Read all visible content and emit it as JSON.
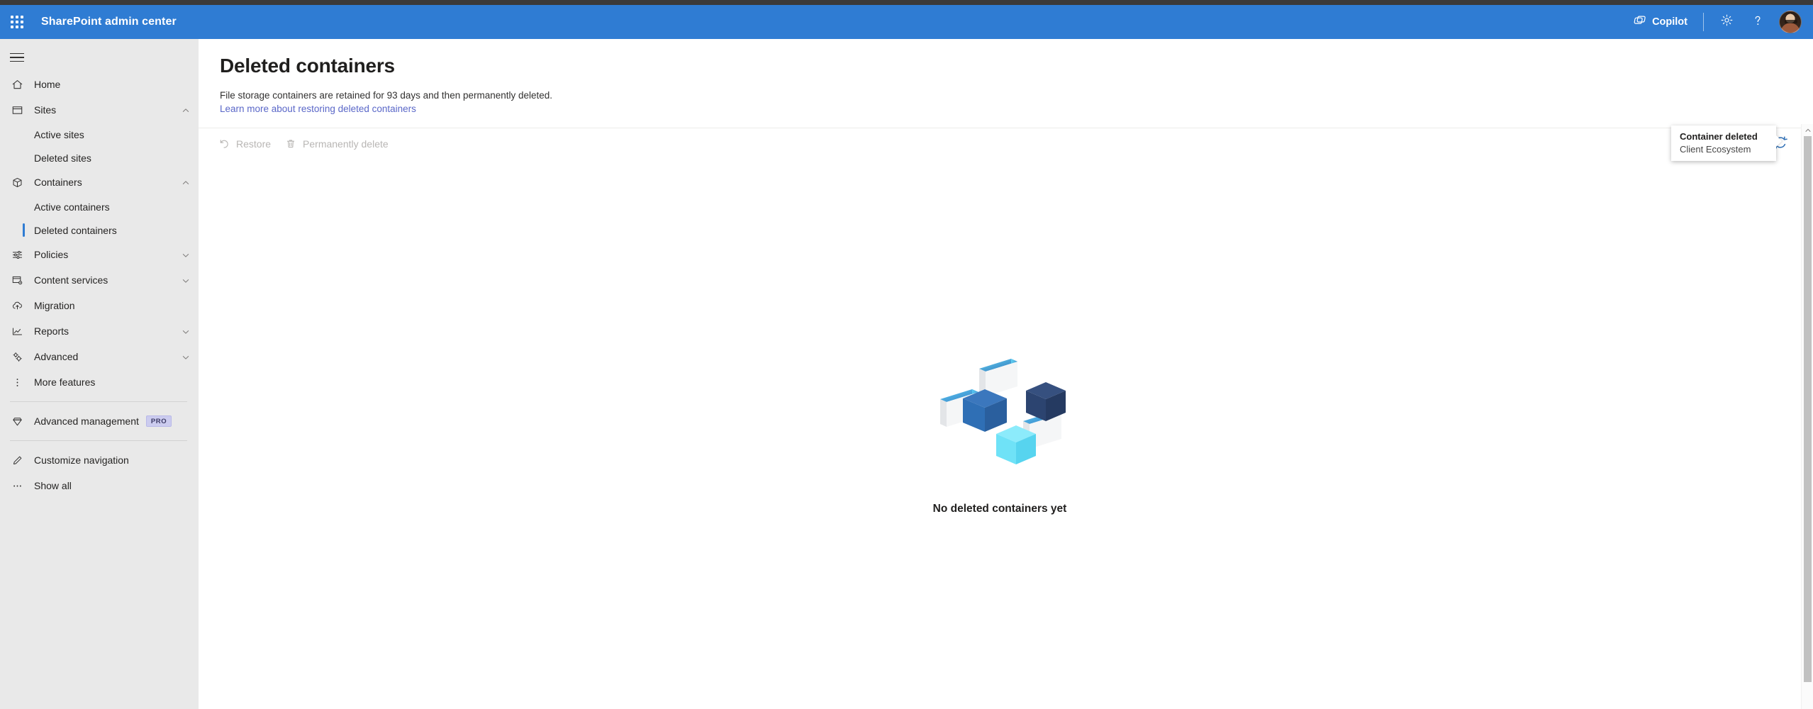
{
  "os": {
    "strip_color": "#3b3a39"
  },
  "suite": {
    "brand": "SharePoint admin center",
    "waffle_icon": "app-launcher-icon",
    "copilot_label": "Copilot",
    "copilot_icon": "copilot-icon",
    "settings_icon": "gear-icon",
    "help_icon": "help-question-icon",
    "avatar_icon": "user-avatar",
    "bar_color": "#2f7cd3"
  },
  "nav": {
    "toggle_icon": "hamburger-menu-icon",
    "items": [
      {
        "label": "Home",
        "icon": "home-icon",
        "type": "item",
        "expandable": false
      },
      {
        "label": "Sites",
        "icon": "sites-icon",
        "type": "item",
        "expandable": true,
        "expanded": true
      },
      {
        "label": "Active sites",
        "type": "sub",
        "selected": false
      },
      {
        "label": "Deleted sites",
        "type": "sub",
        "selected": false
      },
      {
        "label": "Containers",
        "icon": "containers-cube-icon",
        "type": "item",
        "expandable": true,
        "expanded": true
      },
      {
        "label": "Active containers",
        "type": "sub",
        "selected": false
      },
      {
        "label": "Deleted containers",
        "type": "sub",
        "selected": true
      },
      {
        "label": "Policies",
        "icon": "policies-sliders-icon",
        "type": "item",
        "expandable": true,
        "expanded": false
      },
      {
        "label": "Content services",
        "icon": "content-services-icon",
        "type": "item",
        "expandable": true,
        "expanded": false
      },
      {
        "label": "Migration",
        "icon": "migration-cloud-icon",
        "type": "item",
        "expandable": false
      },
      {
        "label": "Reports",
        "icon": "reports-chart-icon",
        "type": "item",
        "expandable": true,
        "expanded": false
      },
      {
        "label": "Advanced",
        "icon": "advanced-gears-icon",
        "type": "item",
        "expandable": true,
        "expanded": false
      },
      {
        "label": "More features",
        "icon": "more-features-ellipsis-icon",
        "type": "item",
        "expandable": false
      }
    ],
    "advanced_management": {
      "label": "Advanced management",
      "icon": "diamond-icon",
      "badge": "PRO"
    },
    "customize_navigation": {
      "label": "Customize navigation",
      "icon": "pencil-edit-icon"
    },
    "show_all": {
      "label": "Show all",
      "icon": "ellipsis-horizontal-icon"
    },
    "selected_indicator_color": "#2f7cd3",
    "background_color": "#e9e9e9"
  },
  "page": {
    "title": "Deleted containers",
    "description": "File storage containers are retained for 93 days and then permanently deleted.",
    "link": "Learn more about restoring deleted containers",
    "link_color": "#5a67c8"
  },
  "command_bar": {
    "restore": {
      "label": "Restore",
      "icon": "restore-arrow-icon",
      "disabled": true
    },
    "permanently_delete": {
      "label": "Permanently delete",
      "icon": "trash-bin-icon",
      "disabled": true
    },
    "refresh": {
      "label": "Refresh",
      "icon": "refresh-circular-arrows-icon"
    },
    "disabled_color": "#b8b6b4"
  },
  "toast": {
    "title": "Container deleted",
    "subtitle": "Client Ecosystem"
  },
  "empty_state": {
    "text": "No deleted containers yet",
    "illustration": "isometric-containers-illustration",
    "colors": {
      "cube_navy": "#2c4470",
      "cube_blue": "#2f6fb5",
      "cube_cyan": "#6fe2f7",
      "card_face": "#f5f6f7",
      "card_edge_top": "#57c8f2",
      "card_edge_bottom": "#2f6fb5"
    }
  },
  "scrollbar": {
    "up_arrow_icon": "scroll-up-arrow-icon",
    "thumb_color": "#c1c1c1"
  }
}
